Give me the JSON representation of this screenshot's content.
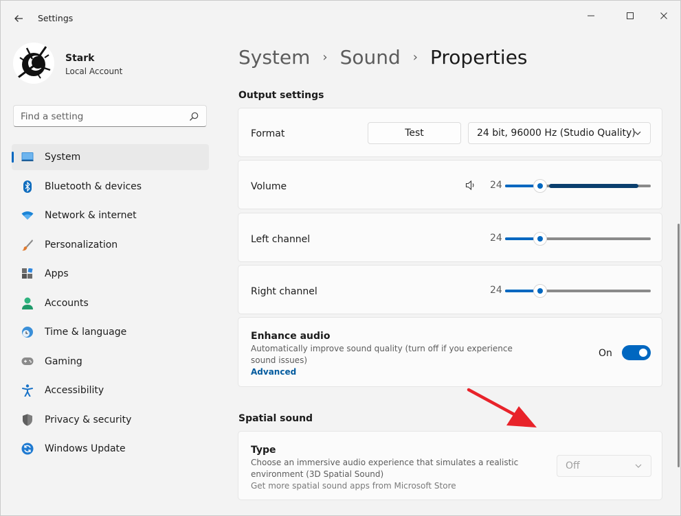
{
  "window": {
    "title": "Settings"
  },
  "user": {
    "name": "Stark",
    "account_type": "Local Account"
  },
  "search": {
    "placeholder": "Find a setting"
  },
  "sidebar": {
    "items": [
      {
        "label": "System",
        "icon": "system-icon",
        "active": true
      },
      {
        "label": "Bluetooth & devices",
        "icon": "bluetooth-icon"
      },
      {
        "label": "Network & internet",
        "icon": "wifi-icon"
      },
      {
        "label": "Personalization",
        "icon": "brush-icon"
      },
      {
        "label": "Apps",
        "icon": "apps-icon"
      },
      {
        "label": "Accounts",
        "icon": "person-icon"
      },
      {
        "label": "Time & language",
        "icon": "clock-globe-icon"
      },
      {
        "label": "Gaming",
        "icon": "gamepad-icon"
      },
      {
        "label": "Accessibility",
        "icon": "accessibility-icon"
      },
      {
        "label": "Privacy & security",
        "icon": "shield-icon"
      },
      {
        "label": "Windows Update",
        "icon": "update-icon"
      }
    ]
  },
  "breadcrumb": {
    "items": [
      "System",
      "Sound"
    ],
    "current": "Properties"
  },
  "output_settings": {
    "heading": "Output settings",
    "format": {
      "label": "Format",
      "test_button": "Test",
      "selected": "24 bit, 96000 Hz (Studio Quality)"
    },
    "volume": {
      "label": "Volume",
      "value": "24",
      "percent": 24
    },
    "left_channel": {
      "label": "Left channel",
      "value": "24",
      "percent": 24
    },
    "right_channel": {
      "label": "Right channel",
      "value": "24",
      "percent": 24
    },
    "enhance_audio": {
      "title": "Enhance audio",
      "description_line1": "Automatically improve sound quality (turn off if you experience",
      "description_line2": "sound issues)",
      "link": "Advanced",
      "state": "On"
    }
  },
  "spatial_sound": {
    "heading": "Spatial sound",
    "type": {
      "title": "Type",
      "description_line1": "Choose an immersive audio experience that simulates a realistic",
      "description_line2": "environment (3D Spatial Sound)",
      "link": "Get more spatial sound apps from Microsoft Store",
      "selected": "Off"
    }
  },
  "colors": {
    "accent": "#0067c0",
    "annotation_arrow": "#e8232a"
  }
}
